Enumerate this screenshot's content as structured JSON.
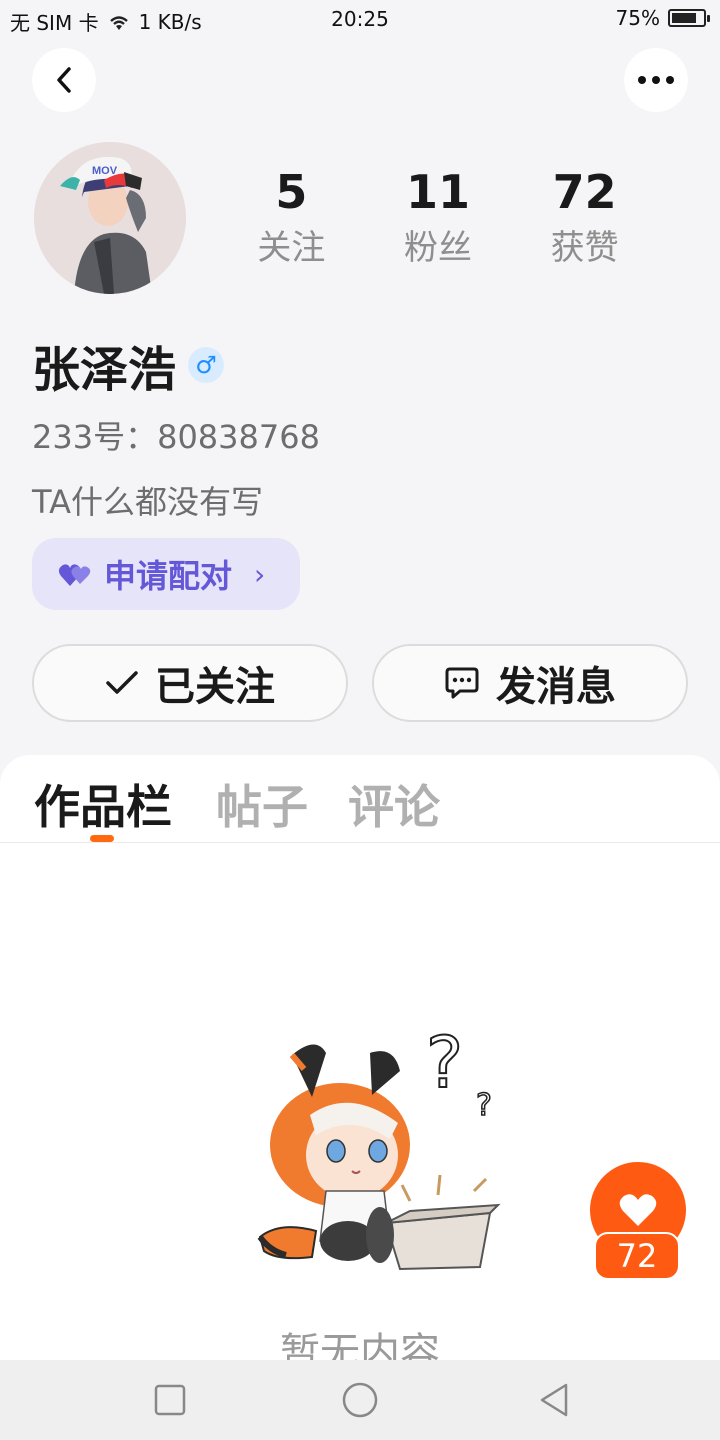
{
  "status_bar": {
    "carrier": "无 SIM 卡",
    "speed": "1 KB/s",
    "time": "20:25",
    "battery": "75%",
    "battery_level": 0.75
  },
  "profile": {
    "name": "张泽浩",
    "gender_symbol": "♂",
    "id_line": "233号：80838768",
    "bio": "TA什么都没有写",
    "stats": [
      {
        "value": "5",
        "label": "关注"
      },
      {
        "value": "11",
        "label": "粉丝"
      },
      {
        "value": "72",
        "label": "获赞"
      }
    ]
  },
  "pair_button": {
    "label": "申请配对",
    "chevron": "›"
  },
  "actions": {
    "follow_label": "已关注",
    "message_label": "发消息"
  },
  "tabs": [
    {
      "label": "作品栏",
      "active": true
    },
    {
      "label": "帖子",
      "active": false
    },
    {
      "label": "评论",
      "active": false
    }
  ],
  "empty_state": {
    "text": "暂无内容"
  },
  "like_fab": {
    "count": "72"
  },
  "colors": {
    "accent_orange": "#ff5a12",
    "pair_purple": "#6457d8",
    "gender_blue": "#1e8fff"
  }
}
